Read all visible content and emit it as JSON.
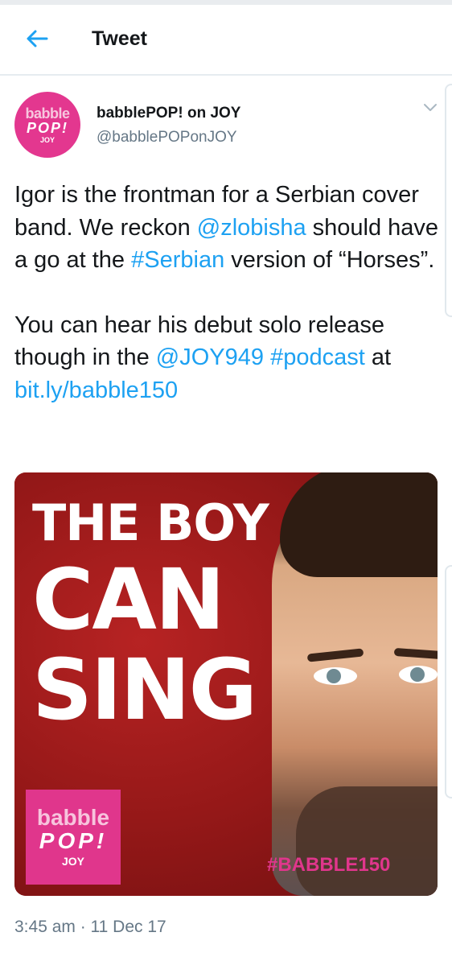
{
  "header": {
    "back_icon": "arrow-left-icon",
    "title": "Tweet",
    "accent_color": "#1da1f2"
  },
  "tweet": {
    "author": {
      "display_name": "babblePOP! on JOY",
      "handle": "@babblePOPonJOY",
      "avatar": {
        "line1": "babble",
        "line2": "POP!",
        "line3": "JOY"
      }
    },
    "menu_icon": "chevron-down-icon",
    "text": {
      "p1": {
        "s1": "Igor is the frontman for a Serbian cover band. We reckon ",
        "mention1": "@zlobisha",
        "s2": " should have a go at the ",
        "hashtag1": "#Serbian",
        "s3": " version of “Horses”."
      },
      "p2": {
        "s1": "You can hear his debut solo release though in the ",
        "mention2": "@JOY949",
        "s2": " ",
        "hashtag2": "#podcast",
        "s3": " at ",
        "url": "bit.ly/babble150"
      }
    },
    "media": {
      "headline_line1": "THE BOY",
      "headline_line2": "CAN",
      "headline_line3": "SING",
      "logo": {
        "line1": "babble",
        "line2": "POP!",
        "line3": "JOY"
      },
      "hashtag": "#BABBLE150",
      "background_color": "#951818",
      "logo_color": "#e0368c"
    },
    "timestamp": "3:45 am · 11 Dec 17"
  }
}
